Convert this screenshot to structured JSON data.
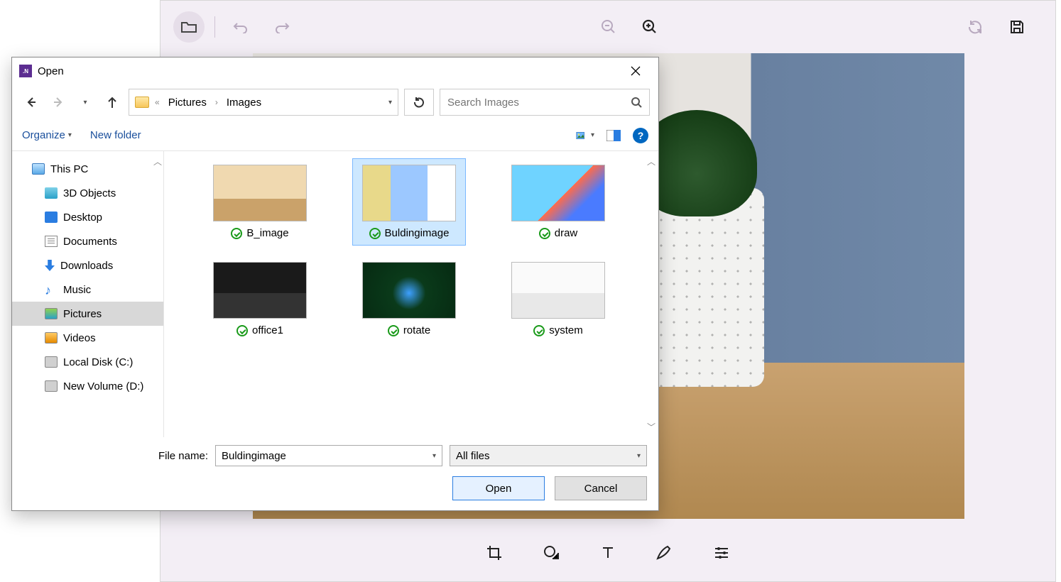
{
  "app": {
    "toolbar": {
      "open_icon": "folder",
      "undo_icon": "undo",
      "redo_icon": "redo",
      "zoom_out_icon": "zoom-out",
      "zoom_in_icon": "zoom-in",
      "reset_icon": "reset",
      "save_icon": "save"
    },
    "bottom_toolbar": {
      "crop": "crop",
      "shape": "shape",
      "text": "text",
      "pen": "pen",
      "adjust": "adjust"
    }
  },
  "dialog": {
    "title": "Open",
    "breadcrumb": {
      "a": "Pictures",
      "b": "Images"
    },
    "search_placeholder": "Search Images",
    "commands": {
      "organize": "Organize",
      "new_folder": "New folder"
    },
    "tree": {
      "this_pc": "This PC",
      "objects3d": "3D Objects",
      "desktop": "Desktop",
      "documents": "Documents",
      "downloads": "Downloads",
      "music": "Music",
      "pictures": "Pictures",
      "videos": "Videos",
      "local_disk": "Local Disk (C:)",
      "new_volume": "New Volume (D:)"
    },
    "files": [
      {
        "name": "B_image"
      },
      {
        "name": "Buldingimage"
      },
      {
        "name": "draw"
      },
      {
        "name": "office1"
      },
      {
        "name": "rotate"
      },
      {
        "name": "system"
      }
    ],
    "footer": {
      "file_name_label": "File name:",
      "file_name_value": "Buldingimage",
      "filter": "All files",
      "open": "Open",
      "cancel": "Cancel"
    }
  }
}
